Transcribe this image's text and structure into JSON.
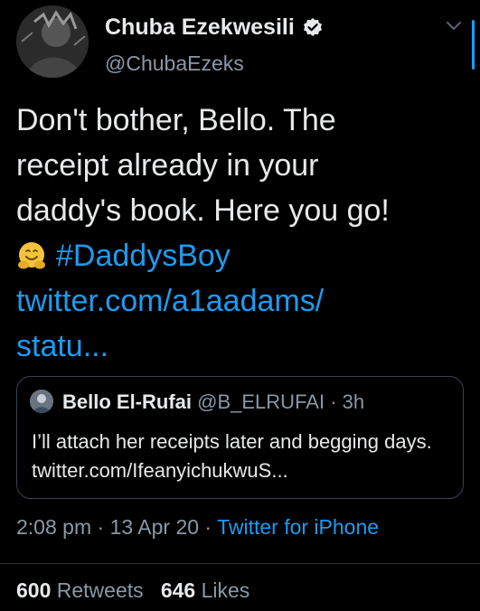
{
  "author": {
    "name": "Chuba Ezekwesili",
    "handle": "@ChubaEzeks",
    "verified": true
  },
  "tweet": {
    "text_line1": "Don't bother, Bello. The",
    "text_line2": "receipt already in your",
    "text_line3": "daddy's book. Here you go!",
    "emoji": "hugging-face-emoji",
    "hashtag": "#DaddysBoy",
    "link_line1": "twitter.com/a1aadams/",
    "link_line2": "statu..."
  },
  "quoted_tweet": {
    "name": "Bello El-Rufai",
    "handle": "@B_ELRUFAI",
    "separator": "·",
    "time": "3h",
    "body": "I’ll attach her receipts later and begging days. twitter.com/IfeanyichukwuS..."
  },
  "meta": {
    "time": "2:08 pm",
    "date": "13 Apr 20",
    "source": "Twitter for iPhone",
    "separator": "·"
  },
  "stats": {
    "retweets_count": "600",
    "retweets_label": "Retweets",
    "likes_count": "646",
    "likes_label": "Likes"
  },
  "colors": {
    "background": "#000000",
    "link": "#1d9bf0",
    "secondary_text": "#8b98a5"
  }
}
